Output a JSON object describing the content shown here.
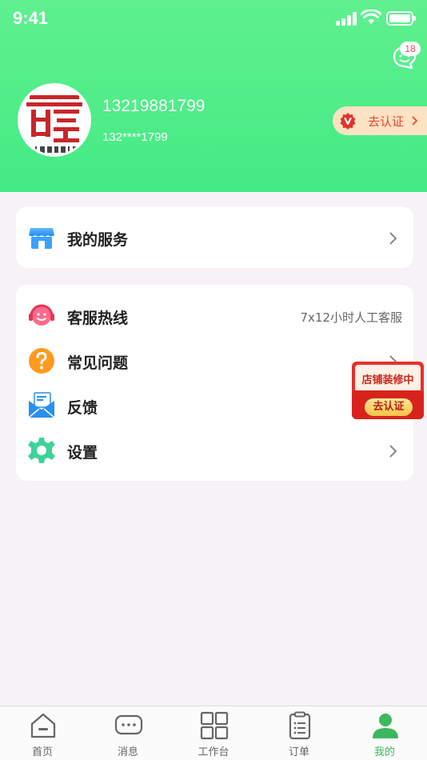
{
  "status_bar": {
    "time": "9:41"
  },
  "header": {
    "message_badge": "18",
    "phone": "13219881799",
    "phone_masked": "132****1799",
    "verify_label": "去认证"
  },
  "service_card": {
    "label": "我的服务"
  },
  "menu": {
    "items": [
      {
        "label": "客服热线",
        "extra": "7x12小时人工客服"
      },
      {
        "label": "常见问题"
      },
      {
        "label": "反馈"
      },
      {
        "label": "设置"
      }
    ]
  },
  "floating_banner": {
    "title": "店铺装修中",
    "button": "去认证"
  },
  "tabbar": {
    "tabs": [
      {
        "label": "首页",
        "icon": "home-icon"
      },
      {
        "label": "消息",
        "icon": "chat-icon"
      },
      {
        "label": "工作台",
        "icon": "grid-icon"
      },
      {
        "label": "订单",
        "icon": "clipboard-icon"
      },
      {
        "label": "我的",
        "icon": "user-icon",
        "active": true
      }
    ]
  },
  "colors": {
    "header_green": "#4ded87",
    "accent_red": "#e04a2e",
    "tab_active": "#3cb85e"
  }
}
